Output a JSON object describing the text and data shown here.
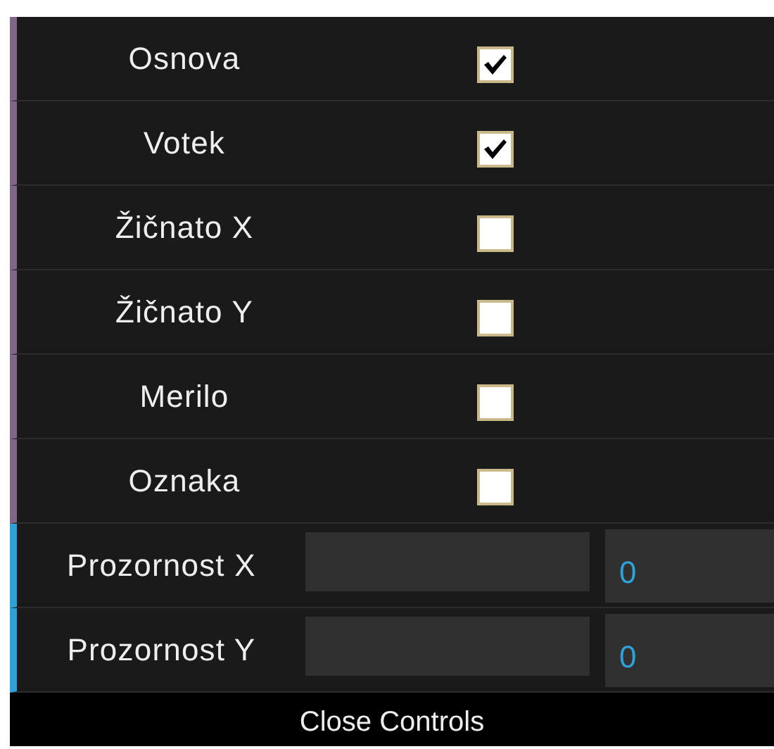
{
  "controls": [
    {
      "kind": "boolean",
      "label": "Osnova",
      "checked": true
    },
    {
      "kind": "boolean",
      "label": "Votek",
      "checked": true
    },
    {
      "kind": "boolean",
      "label": "Žičnato X",
      "checked": false
    },
    {
      "kind": "boolean",
      "label": "Žičnato Y",
      "checked": false
    },
    {
      "kind": "boolean",
      "label": "Merilo",
      "checked": false
    },
    {
      "kind": "boolean",
      "label": "Oznaka",
      "checked": false
    },
    {
      "kind": "number",
      "label": "Prozornost X",
      "level": 0,
      "value": "0"
    },
    {
      "kind": "number",
      "label": "Prozornost Y",
      "level": 0,
      "value": "0"
    }
  ],
  "close_button": "Close Controls"
}
